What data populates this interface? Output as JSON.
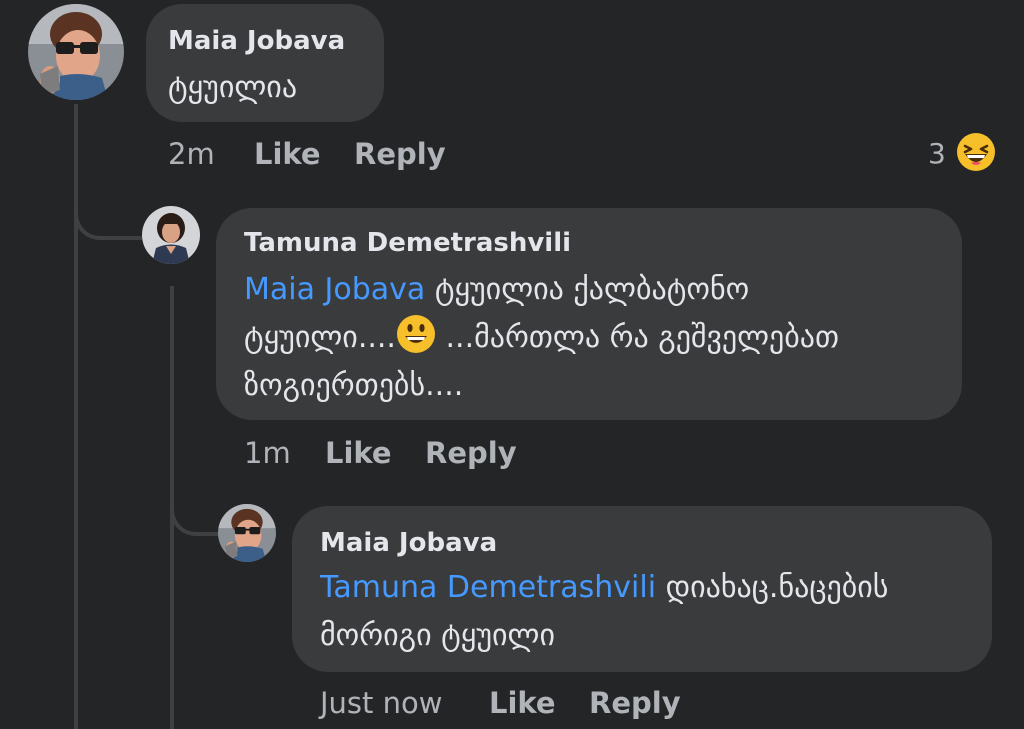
{
  "comments": [
    {
      "author": "Maia Jobava",
      "text": "ტყუილია",
      "time": "2m",
      "like_label": "Like",
      "reply_label": "Reply",
      "reaction_count": "3",
      "reaction_icon": "grinning-squinting-face-icon"
    },
    {
      "author": "Tamuna Demetrashvili",
      "mention": "Maia Jobava",
      "line1_text": " ტყუილია ქალბატონო",
      "line2_before": "ტყუილი....",
      "line2_after": " ...მართლა რა გეშველებათ",
      "line3": "ზოგიერთებს....",
      "inline_emoji": "grinning-face-icon",
      "time": "1m",
      "like_label": "Like",
      "reply_label": "Reply"
    },
    {
      "author": "Maia Jobava",
      "mention": "Tamuna Demetrashvili",
      "line1_text": " დიახაც.ნაცების",
      "line2": "მორიგი ტყუილი",
      "time": "Just now",
      "like_label": "Like",
      "reply_label": "Reply"
    }
  ],
  "colors": {
    "background": "#242526",
    "bubble": "#3a3b3c",
    "text": "#e4e6eb",
    "secondary_text": "#b0b3b8",
    "mention": "#4599ff",
    "thread_line": "#3e4042"
  }
}
